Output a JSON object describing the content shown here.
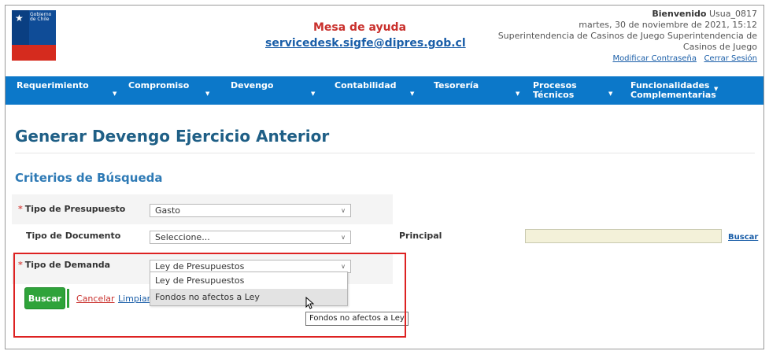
{
  "header": {
    "logo_text": "Gobierno de Chile",
    "help_title": "Mesa de ayuda",
    "help_email": "servicedesk.sigfe@dipres.gob.cl",
    "welcome_label": "Bienvenido",
    "user": "Usua_0817",
    "date": "martes, 30 de noviembre de 2021, 15:12",
    "org_line1": "Superintendencia de Casinos de Juego Superintendencia de",
    "org_line2": "Casinos de Juego",
    "change_password": "Modificar Contraseña",
    "logout": "Cerrar Sesión"
  },
  "nav": {
    "items": [
      {
        "line1": "Requerimiento",
        "line2": ""
      },
      {
        "line1": "Compromiso",
        "line2": ""
      },
      {
        "line1": "Devengo",
        "line2": ""
      },
      {
        "line1": "Contabilidad",
        "line2": ""
      },
      {
        "line1": "Tesorería",
        "line2": ""
      },
      {
        "line1": "Procesos",
        "line2": "Técnicos"
      },
      {
        "line1": "Funcionalidades",
        "line2": "Complementarias"
      }
    ]
  },
  "page": {
    "title": "Generar Devengo Ejercicio Anterior",
    "section": "Criterios de Búsqueda"
  },
  "form": {
    "tipo_presupuesto_label": "Tipo de Presupuesto",
    "tipo_presupuesto_value": "Gasto",
    "tipo_documento_label": "Tipo de Documento",
    "tipo_documento_value": "Seleccione...",
    "principal_label": "Principal",
    "buscar_link": "Buscar",
    "tipo_demanda_label": "Tipo de Demanda",
    "tipo_demanda_value": "Ley de Presupuestos",
    "required_mark": "*"
  },
  "dropdown": {
    "options": [
      "Ley de Presupuestos",
      "Fondos no afectos a Ley"
    ],
    "tooltip": "Fondos no afectos a Ley"
  },
  "actions": {
    "buscar": "Buscar",
    "cancelar": "Cancelar",
    "limpiar": "Limpiar"
  },
  "colors": {
    "nav_bg": "#0c78c9",
    "title": "#1f5f86",
    "section": "#2e7ab5",
    "button": "#2fa33a",
    "highlight": "#dd2222"
  }
}
